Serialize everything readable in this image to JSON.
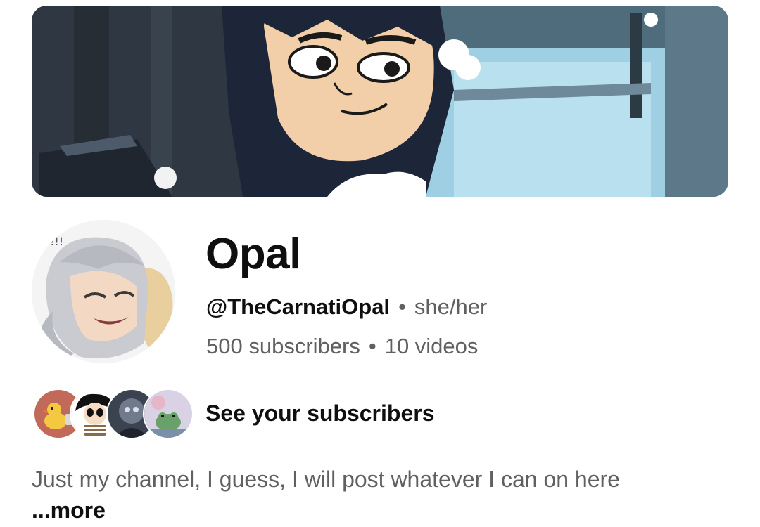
{
  "channel": {
    "name": "Opal",
    "handle": "@TheCarnatiOpal",
    "pronouns": "she/her",
    "subscribers": "500 subscribers",
    "videos": "10 videos",
    "separator": "•"
  },
  "subscribers_preview": {
    "label": "See your subscribers",
    "avatar_icons": [
      "duck-avatar-icon",
      "cartoon-girl-avatar-icon",
      "dark-creature-avatar-icon",
      "frog-avatar-icon"
    ]
  },
  "description": {
    "text": "Just my channel, I guess, I will post whatever I can on here ",
    "more_label": "...more"
  },
  "colors": {
    "primary_text": "#0f0f0f",
    "secondary_text": "#606060",
    "background": "#ffffff"
  }
}
